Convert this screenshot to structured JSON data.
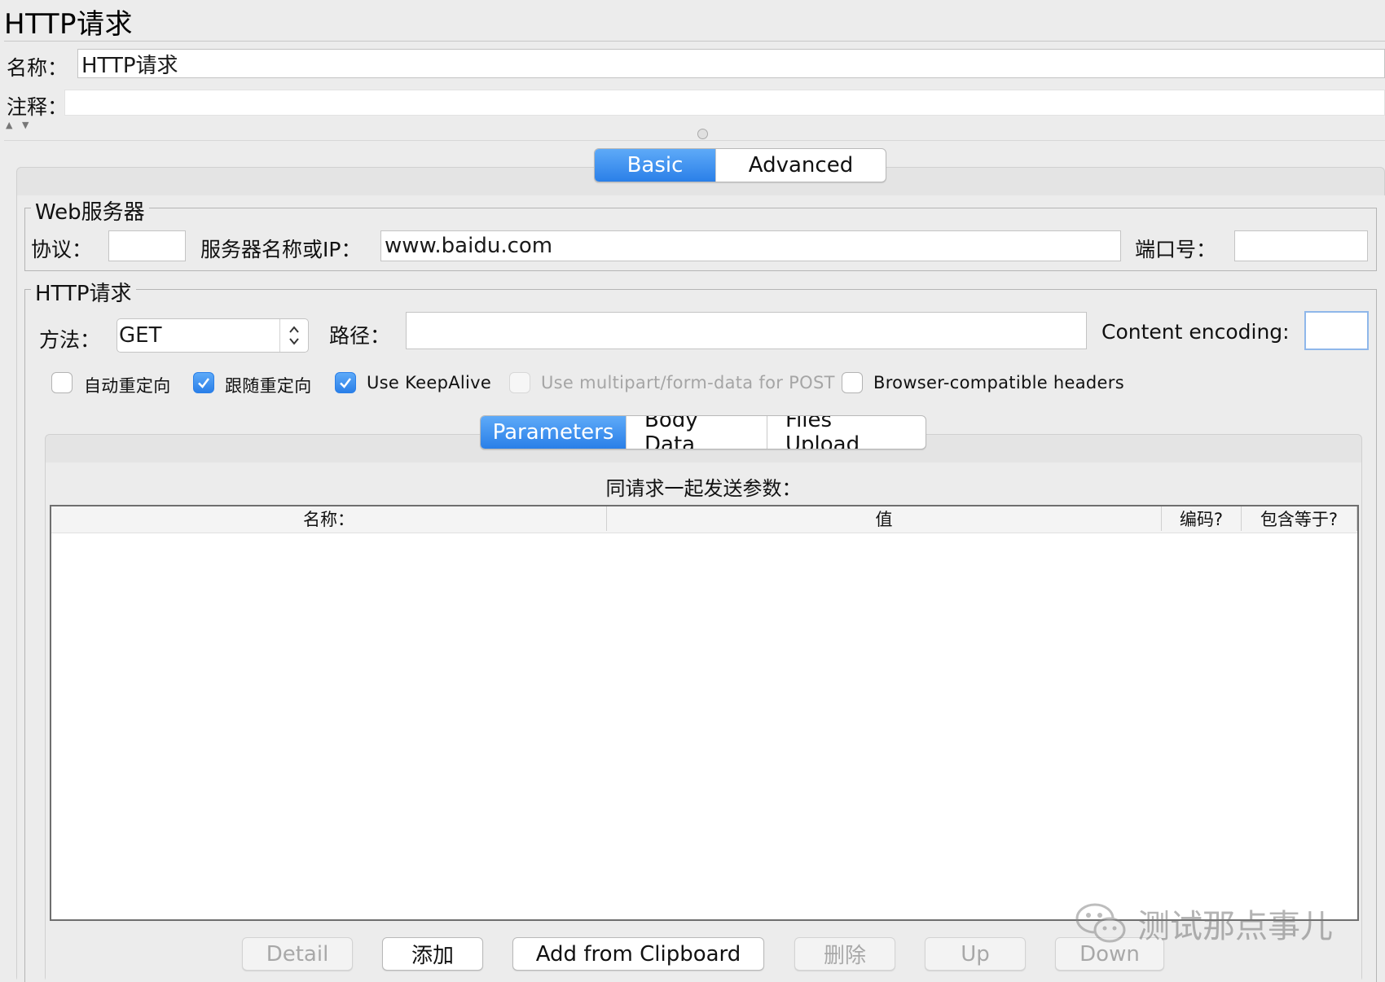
{
  "header": {
    "title": "HTTP请求"
  },
  "form": {
    "name_label": "名称：",
    "name_value": "HTTP请求",
    "comment_label": "注释：",
    "comment_value": ""
  },
  "main_tabs": [
    {
      "label": "Basic",
      "active": true
    },
    {
      "label": "Advanced",
      "active": false
    }
  ],
  "web_server": {
    "title": "Web服务器",
    "protocol_label": "协议：",
    "protocol_value": "",
    "server_label": "服务器名称或IP：",
    "server_value": "www.baidu.com",
    "port_label": "端口号：",
    "port_value": ""
  },
  "http_request": {
    "title": "HTTP请求",
    "method_label": "方法：",
    "method_value": "GET",
    "path_label": "路径：",
    "path_value": "",
    "encoding_label": "Content encoding:",
    "encoding_value": "",
    "checkboxes": [
      {
        "label": "自动重定向",
        "checked": false,
        "disabled": false
      },
      {
        "label": "跟随重定向",
        "checked": true,
        "disabled": false
      },
      {
        "label": "Use KeepAlive",
        "checked": true,
        "disabled": false
      },
      {
        "label": "Use multipart/form-data for POST",
        "checked": false,
        "disabled": true
      },
      {
        "label": "Browser-compatible headers",
        "checked": false,
        "disabled": false
      }
    ]
  },
  "sub_tabs": [
    {
      "label": "Parameters",
      "active": true
    },
    {
      "label": "Body Data",
      "active": false
    },
    {
      "label": "Files Upload",
      "active": false
    }
  ],
  "params": {
    "heading": "同请求一起发送参数：",
    "columns": [
      "名称：",
      "值",
      "编码?",
      "包含等于?"
    ],
    "rows": []
  },
  "buttons": [
    {
      "label": "Detail",
      "disabled": true
    },
    {
      "label": "添加",
      "disabled": false
    },
    {
      "label": "Add from Clipboard",
      "disabled": false
    },
    {
      "label": "删除",
      "disabled": true
    },
    {
      "label": "Up",
      "disabled": true
    },
    {
      "label": "Down",
      "disabled": true
    }
  ],
  "watermark": {
    "text": "测试那点事儿"
  },
  "colors": {
    "accent": "#2a7fe8",
    "background": "#ececec"
  }
}
